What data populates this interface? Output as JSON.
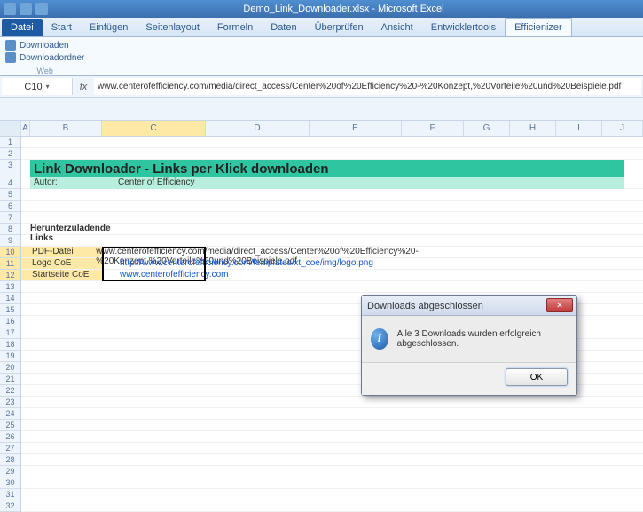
{
  "app": {
    "doc_title": "Demo_Link_Downloader.xlsx - Microsoft Excel"
  },
  "tabs": {
    "file": "Datei",
    "items": [
      "Start",
      "Einfügen",
      "Seitenlayout",
      "Formeln",
      "Daten",
      "Überprüfen",
      "Ansicht",
      "Entwicklertools",
      "Efficienizer"
    ],
    "active_index": 8
  },
  "ribbon": {
    "downloaden": "Downloaden",
    "downloadordner": "Downloadordner",
    "group_label": "Web"
  },
  "formula_bar": {
    "cell_ref": "C10",
    "fx": "fx",
    "value": "www.centerofefficiency.com/media/direct_access/Center%20of%20Efficiency%20-%20Konzept,%20Vorteile%20und%20Beispiele.pdf"
  },
  "columns": [
    "A",
    "B",
    "C",
    "D",
    "E",
    "F",
    "G",
    "H",
    "I",
    "J"
  ],
  "rows_visible": 32,
  "selected_rows": [
    10,
    11,
    12
  ],
  "content": {
    "title": "Link Downloader - Links per Klick downloaden",
    "autor_label": "Autor:",
    "autor_value": "Center of Efficiency",
    "section": "Herunterzuladende Links",
    "links": [
      {
        "name": "PDF-Datei",
        "url": "www.centerofefficiency.com/media/direct_access/Center%20of%20Efficiency%20-%20Konzept,%20Vorteile%20und%20Beispiele.pdf",
        "blue": false
      },
      {
        "name": "Logo CoE",
        "url": "http://www.centerofefficiency.com/templates/xt_coe/img/logo.png",
        "blue": true
      },
      {
        "name": "Startseite CoE",
        "url": "www.centerofefficiency.com",
        "blue": true
      }
    ]
  },
  "dialog": {
    "title": "Downloads abgeschlossen",
    "message": "Alle 3 Downloads wurden erfolgreich abgeschlossen.",
    "ok": "OK",
    "close": "✕"
  }
}
